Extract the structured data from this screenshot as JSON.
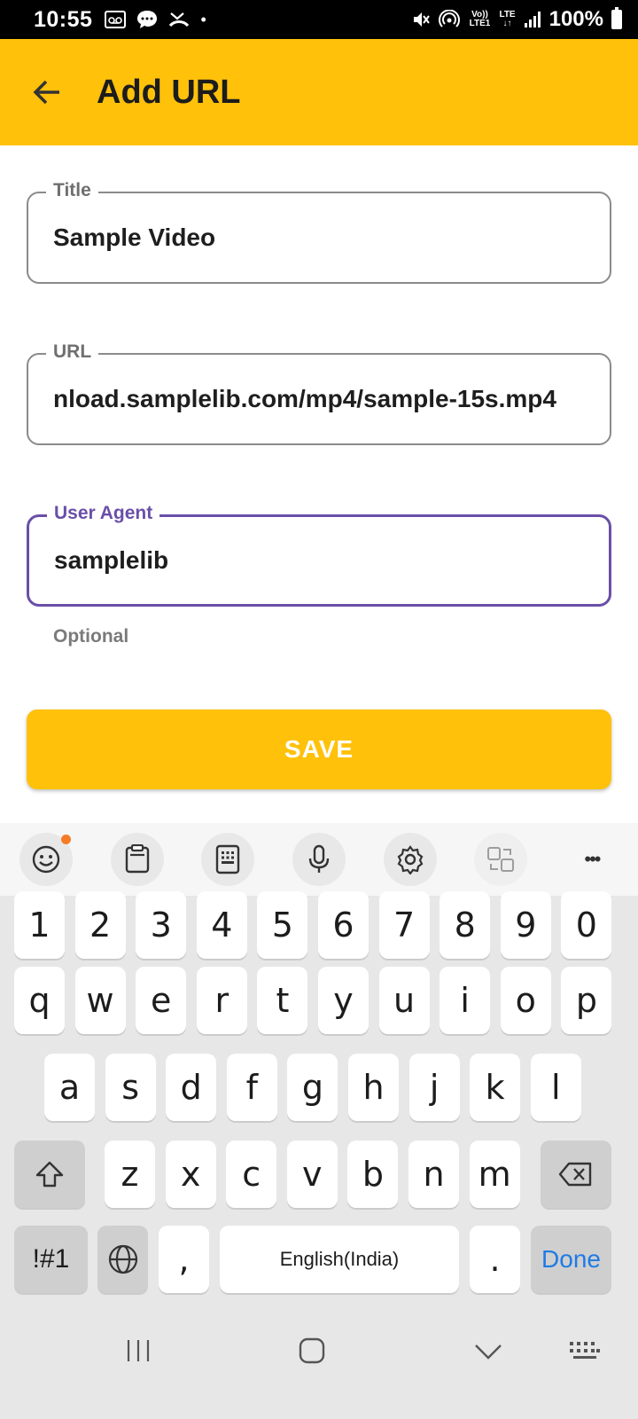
{
  "status_bar": {
    "time": "10:55",
    "battery": "100%",
    "network": "LTE",
    "volte": "Vo)) LTE1"
  },
  "app_bar": {
    "title": "Add URL",
    "background": "#FFC10A"
  },
  "form": {
    "title_field": {
      "label": "Title",
      "value": "Sample Video"
    },
    "url_field": {
      "label": "URL",
      "value": "nload.samplelib.com/mp4/sample-15s.mp4"
    },
    "user_agent_field": {
      "label": "User Agent",
      "value": "samplelib",
      "helper": "Optional",
      "focus_color": "#6A4FA8"
    },
    "save_label": "SAVE"
  },
  "keyboard": {
    "toolbar_icons": [
      "emoji-icon",
      "clipboard-icon",
      "keypad-icon",
      "microphone-icon",
      "settings-icon",
      "translate-icon",
      "more-icon"
    ],
    "more_label": "•••",
    "number_row": [
      "1",
      "2",
      "3",
      "4",
      "5",
      "6",
      "7",
      "8",
      "9",
      "0"
    ],
    "row1": [
      "q",
      "w",
      "e",
      "r",
      "t",
      "y",
      "u",
      "i",
      "o",
      "p"
    ],
    "row2": [
      "a",
      "s",
      "d",
      "f",
      "g",
      "h",
      "j",
      "k",
      "l"
    ],
    "row3": [
      "z",
      "x",
      "c",
      "v",
      "b",
      "n",
      "m"
    ],
    "symbols_label": "!#1",
    "comma": ",",
    "space_label": "English(India)",
    "period": ".",
    "done_label": "Done"
  }
}
